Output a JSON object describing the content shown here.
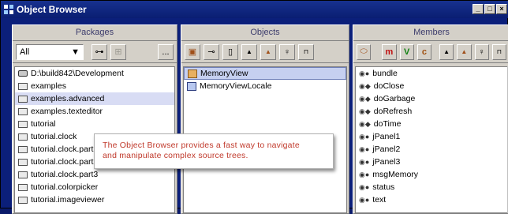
{
  "window": {
    "title": "Object Browser"
  },
  "packages": {
    "header": "Packages",
    "filter_value": "All",
    "ellipsis_label": "...",
    "items": [
      {
        "label": "D:\\build842\\Development",
        "icon": "drive-icon"
      },
      {
        "label": "examples",
        "icon": "folder-icon"
      },
      {
        "label": "examples.advanced",
        "icon": "folder-icon",
        "selected": true
      },
      {
        "label": "examples.texteditor",
        "icon": "folder-icon"
      },
      {
        "label": "tutorial",
        "icon": "folder-icon"
      },
      {
        "label": "tutorial.clock",
        "icon": "folder-icon"
      },
      {
        "label": "tutorial.clock.part1",
        "icon": "folder-icon"
      },
      {
        "label": "tutorial.clock.part2",
        "icon": "folder-icon"
      },
      {
        "label": "tutorial.clock.part3",
        "icon": "folder-icon"
      },
      {
        "label": "tutorial.colorpicker",
        "icon": "folder-icon"
      },
      {
        "label": "tutorial.imageviewer",
        "icon": "folder-icon"
      }
    ]
  },
  "objects": {
    "header": "Objects",
    "items": [
      {
        "label": "MemoryView",
        "icon": "class-icon",
        "selected": true
      },
      {
        "label": "MemoryViewLocale",
        "icon": "class-icon"
      }
    ]
  },
  "members": {
    "header": "Members",
    "toolbar": {
      "m_label": "m",
      "v_label": "V",
      "c_label": "c"
    },
    "items": [
      {
        "label": "bundle",
        "icon": "field-icon"
      },
      {
        "label": "doClose",
        "icon": "method-icon"
      },
      {
        "label": "doGarbage",
        "icon": "method-icon"
      },
      {
        "label": "doRefresh",
        "icon": "method-icon"
      },
      {
        "label": "doTime",
        "icon": "method-icon"
      },
      {
        "label": "jPanel1",
        "icon": "field-icon"
      },
      {
        "label": "jPanel2",
        "icon": "field-icon"
      },
      {
        "label": "jPanel3",
        "icon": "field-icon"
      },
      {
        "label": "msgMemory",
        "icon": "field-icon"
      },
      {
        "label": "status",
        "icon": "field-icon"
      },
      {
        "label": "text",
        "icon": "field-icon"
      }
    ]
  },
  "callout": {
    "line1": "The Object Browser provides a fast way to navigate",
    "line2": "and manipulate complex source trees."
  },
  "colors": {
    "title_bar": "#0a1e72",
    "panel": "#d4d0c8",
    "callout_text": "#c0392b",
    "selection": "#d8dcf4"
  }
}
